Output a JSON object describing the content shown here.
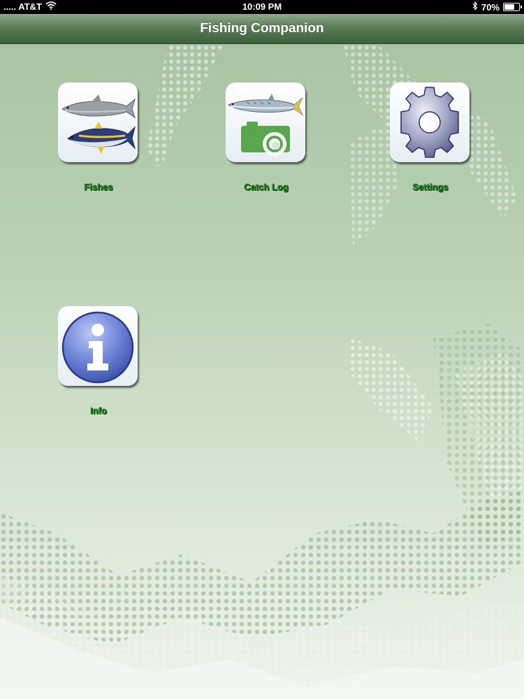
{
  "status_bar": {
    "carrier": "..... AT&T",
    "time": "10:09 PM",
    "battery_percent": "70%",
    "battery_level": 0.7,
    "icons": [
      "wifi-icon",
      "bluetooth-icon",
      "battery-icon"
    ]
  },
  "nav": {
    "title": "Fishing Companion"
  },
  "colors": {
    "nav_bar": "#4f724c",
    "label_green": "#1c8a1c",
    "background_green": "#bcd2b6"
  },
  "launcher": {
    "fishes": {
      "label": "Fishes",
      "icon": "fish-species-icon"
    },
    "catch_log": {
      "label": "Catch Log",
      "icon": "catch-log-camera-icon"
    },
    "settings": {
      "label": "Settings",
      "icon": "gear-icon"
    },
    "info": {
      "label": "Info",
      "icon": "info-icon"
    }
  }
}
